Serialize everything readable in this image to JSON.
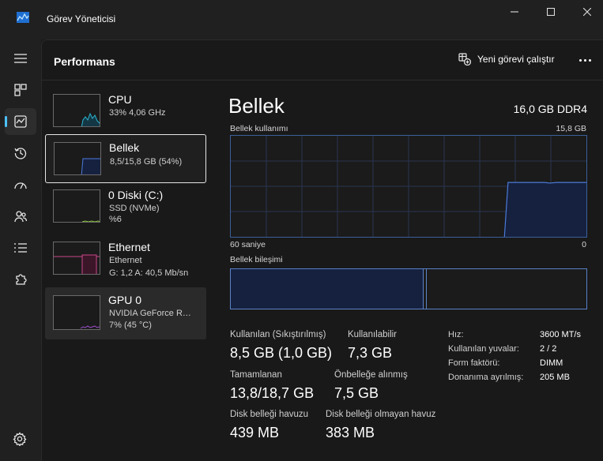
{
  "window": {
    "title": "Görev Yöneticisi",
    "accent_color": "#4cc2ff"
  },
  "nav": {
    "items": [
      {
        "name": "menu",
        "icon": "hamburger-menu-icon"
      },
      {
        "name": "processes",
        "icon": "processes-grid-icon"
      },
      {
        "name": "performance",
        "icon": "performance-chart-icon",
        "active": true
      },
      {
        "name": "app-history",
        "icon": "history-clock-icon"
      },
      {
        "name": "startup-apps",
        "icon": "speedometer-icon"
      },
      {
        "name": "users",
        "icon": "users-icon"
      },
      {
        "name": "details",
        "icon": "details-list-icon"
      },
      {
        "name": "services",
        "icon": "services-puzzle-icon"
      }
    ],
    "settings_icon": "gear-icon"
  },
  "header": {
    "title": "Performans",
    "run_task_label": "Yeni görevi çalıştır",
    "more_icon": "more-dots-icon"
  },
  "resources": [
    {
      "name": "CPU",
      "line1": "33% 4,06 GHz",
      "line2": "",
      "color": "#29b6d4"
    },
    {
      "name": "Bellek",
      "line1": "8,5/15,8 GB (54%)",
      "line2": "",
      "color": "#4a7ad8"
    },
    {
      "name": "0 Diski (C:)",
      "line1": "SSD (NVMe)",
      "line2": "%6",
      "color": "#8cc63f"
    },
    {
      "name": "Ethernet",
      "line1": "Ethernet",
      "line2": "G: 1,2 A: 40,5 Mb/sn",
      "color": "#c9468a"
    },
    {
      "name": "GPU 0",
      "line1": "NVIDIA GeForce R…",
      "line2": "7% (45 °C)",
      "color": "#a04fd0"
    }
  ],
  "detail": {
    "title": "Bellek",
    "spec": "16,0 GB DDR4",
    "usage_label": "Bellek kullanımı",
    "usage_max": "15,8 GB",
    "time_axis_left": "60 saniye",
    "time_axis_right": "0",
    "composition_label": "Bellek bileşimi",
    "composition": {
      "in_use_fraction": 0.54,
      "modified_fraction": 0.01
    },
    "usage_history_gb": [
      0,
      0,
      0,
      0,
      0,
      0,
      0,
      0,
      0,
      0,
      0,
      0,
      0,
      0,
      0,
      0,
      0,
      0,
      0,
      0,
      0,
      0,
      0,
      0,
      0,
      0,
      0,
      0,
      0,
      0,
      0,
      0,
      0,
      0,
      0,
      0,
      0,
      0,
      0,
      0,
      0,
      0,
      0,
      0,
      0,
      0,
      8.5,
      8.5,
      8.5,
      8.5,
      8.5,
      8.5,
      8.5,
      8.4,
      8.5,
      8.5,
      8.5,
      8.5,
      8.5,
      8.5
    ],
    "usage_max_gb": 15.8
  },
  "stats": {
    "in_use_label": "Kullanılan (Sıkıştırılmış)",
    "in_use_value": "8,5 GB (1,0 GB)",
    "available_label": "Kullanılabilir",
    "available_value": "7,3 GB",
    "committed_label": "Tamamlanan",
    "committed_value": "13,8/18,7 GB",
    "cached_label": "Önbelleğe alınmış",
    "cached_value": "7,5 GB",
    "paged_pool_label": "Disk belleği havuzu",
    "paged_pool_value": "439 MB",
    "nonpaged_pool_label": "Disk belleği olmayan havuz",
    "nonpaged_pool_value": "383 MB"
  },
  "properties": [
    {
      "key": "Hız:",
      "value": "3600 MT/s"
    },
    {
      "key": "Kullanılan yuvalar:",
      "value": "2 / 2"
    },
    {
      "key": "Form faktörü:",
      "value": "DIMM"
    },
    {
      "key": "Donanıma ayrılmış:",
      "value": "205 MB"
    }
  ]
}
